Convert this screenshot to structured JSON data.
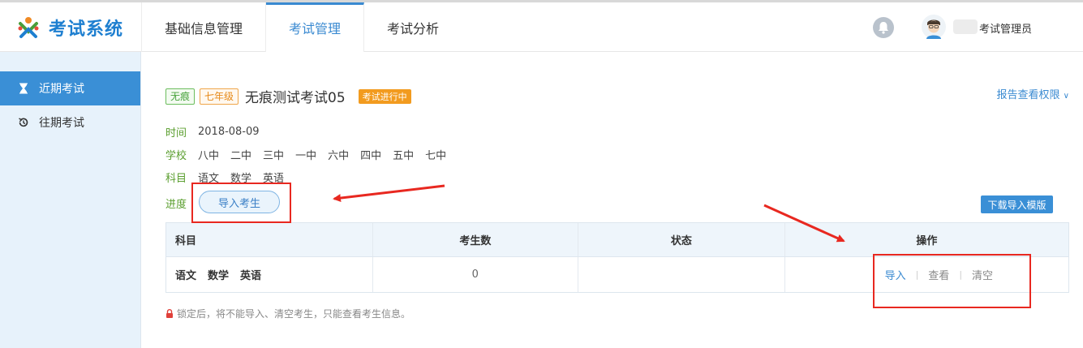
{
  "app": {
    "logo_text": "考试系统",
    "brand_color": "#1e7fd0"
  },
  "nav": {
    "items": [
      {
        "label": "基础信息管理",
        "active": false
      },
      {
        "label": "考试管理",
        "active": true
      },
      {
        "label": "考试分析",
        "active": false
      }
    ]
  },
  "user": {
    "name": "考试管理员",
    "bell_icon": "bell-icon",
    "avatar_icon": "avatar-icon"
  },
  "sidebar": {
    "items": [
      {
        "label": "近期考试",
        "icon": "hourglass-icon",
        "active": true
      },
      {
        "label": "往期考试",
        "icon": "history-icon",
        "active": false
      }
    ]
  },
  "exam": {
    "tags": [
      "无痕",
      "七年级"
    ],
    "name": "无痕测试考试05",
    "status": "考试进行中",
    "report_link": "报告查看权限"
  },
  "info": {
    "time_label": "时间",
    "time_value": "2018-08-09",
    "school_label": "学校",
    "schools": [
      "八中",
      "二中",
      "三中",
      "一中",
      "六中",
      "四中",
      "五中",
      "七中"
    ],
    "subject_label": "科目",
    "subjects": [
      "语文",
      "数学",
      "英语"
    ],
    "progress_label": "进度"
  },
  "buttons": {
    "import_students": "导入考生",
    "download_template": "下载导入模版"
  },
  "table": {
    "headers": [
      "科目",
      "考生数",
      "状态",
      "操作"
    ],
    "row": {
      "subjects": [
        "语文",
        "数学",
        "英语"
      ],
      "count": "0",
      "status": "",
      "actions": [
        "导入",
        "查看",
        "清空"
      ]
    }
  },
  "note": "锁定后，将不能导入、清空考生，只能查看考生信息。",
  "colors": {
    "accent": "#3a8fd6",
    "label_green": "#5a9e2e",
    "status_orange": "#f29b1f",
    "annotation_red": "#e82820"
  }
}
